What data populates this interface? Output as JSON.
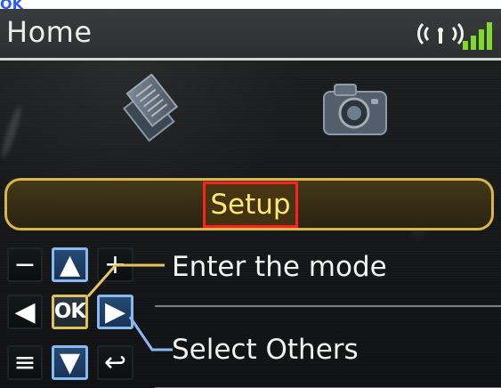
{
  "top_caption": {
    "prefix": "",
    "highlight": "OK"
  },
  "header": {
    "title": "Home",
    "wireless_icon": "wireless-icon",
    "signal_icon": "signal-strength-icon"
  },
  "modes": {
    "left_icon": "copy-mode-icon",
    "right_icon": "photo-mode-icon",
    "selected_label": "Setup"
  },
  "controls": {
    "minus_symbol": "−",
    "up_symbol": "▲",
    "plus_symbol": "+",
    "left_symbol": "◀",
    "ok_label": "OK",
    "right_symbol": "▶",
    "menu_symbol": "≡",
    "down_symbol": "▼",
    "back_symbol": "↩"
  },
  "hints": {
    "enter": "Enter the mode",
    "select": "Select Others"
  },
  "colors": {
    "selection": "#d9b54a",
    "highlight_frame": "#ff2020",
    "selected_text": "#ffe774",
    "control_blue": "#254a73",
    "control_outline": "#8ab9f0",
    "signal": "#7fd92e",
    "caption_highlight": "#2d5bff"
  }
}
